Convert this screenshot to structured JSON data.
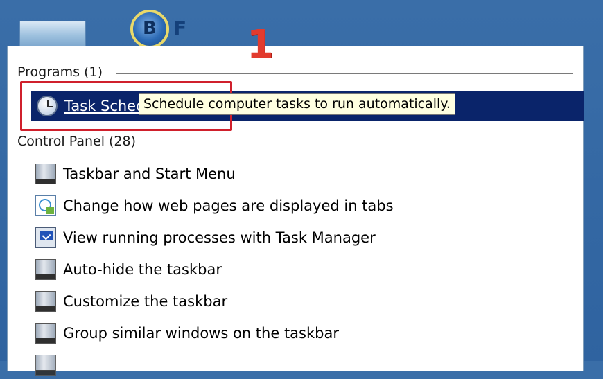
{
  "desktop": {
    "icon1_name": "picture-icon",
    "icon2_letters": {
      "b": "B",
      "f": "F"
    }
  },
  "annotation": {
    "number": "1"
  },
  "programs": {
    "header": "Programs (1)",
    "items": [
      {
        "label": "Task Scheduler",
        "icon": "clock-icon"
      }
    ]
  },
  "tooltip": "Schedule computer tasks to run automatically.",
  "control_panel": {
    "header": "Control Panel (28)",
    "items": [
      {
        "label": "Taskbar and Start Menu",
        "icon": "taskbar-icon"
      },
      {
        "label": "Change how web pages are displayed in tabs",
        "icon": "web-tabs-icon"
      },
      {
        "label": "View running processes with Task Manager",
        "icon": "task-manager-icon"
      },
      {
        "label": "Auto-hide the taskbar",
        "icon": "taskbar-icon"
      },
      {
        "label": "Customize the taskbar",
        "icon": "taskbar-icon"
      },
      {
        "label": "Group similar windows on the taskbar",
        "icon": "taskbar-icon"
      }
    ]
  },
  "colors": {
    "selection": "#0a246a",
    "annotation": "#d0202c",
    "desktop": "#3a6ea8"
  }
}
